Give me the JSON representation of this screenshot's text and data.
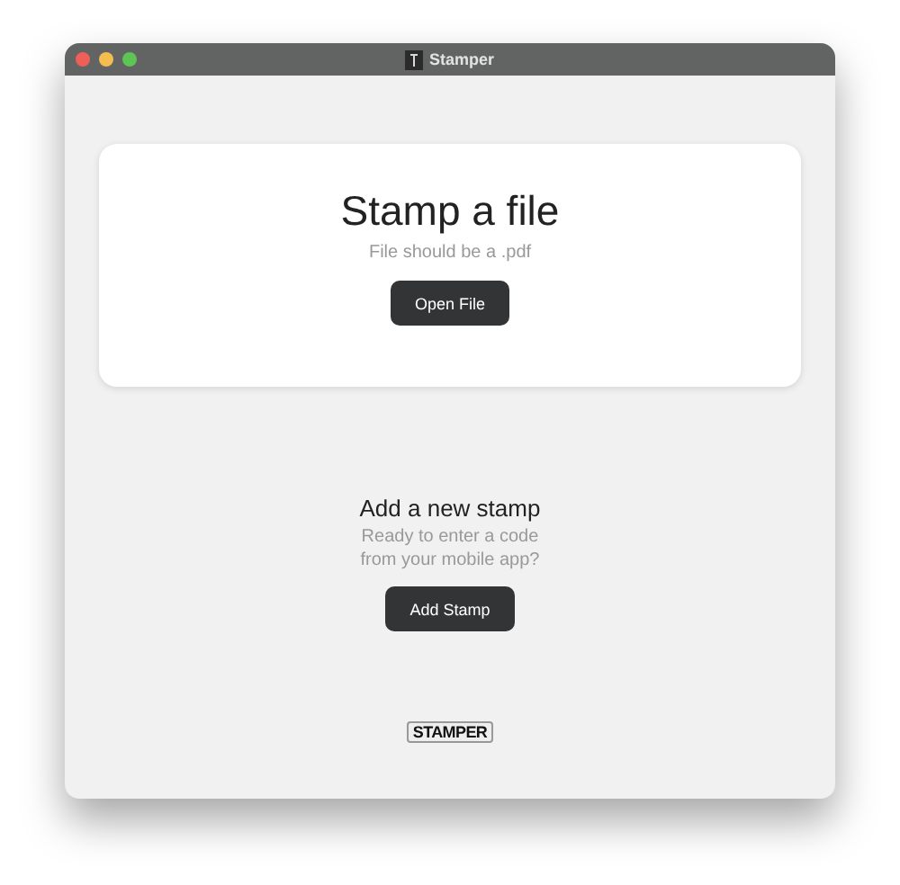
{
  "window": {
    "title": "Stamper"
  },
  "file_card": {
    "heading": "Stamp a file",
    "hint": "File should be a .pdf",
    "button": "Open File"
  },
  "new_stamp": {
    "heading": "Add a new stamp",
    "hint_lines": [
      "Ready to enter a code",
      "from your mobile app?"
    ],
    "button": "Add Stamp"
  },
  "footer_logo": "STAMPER"
}
